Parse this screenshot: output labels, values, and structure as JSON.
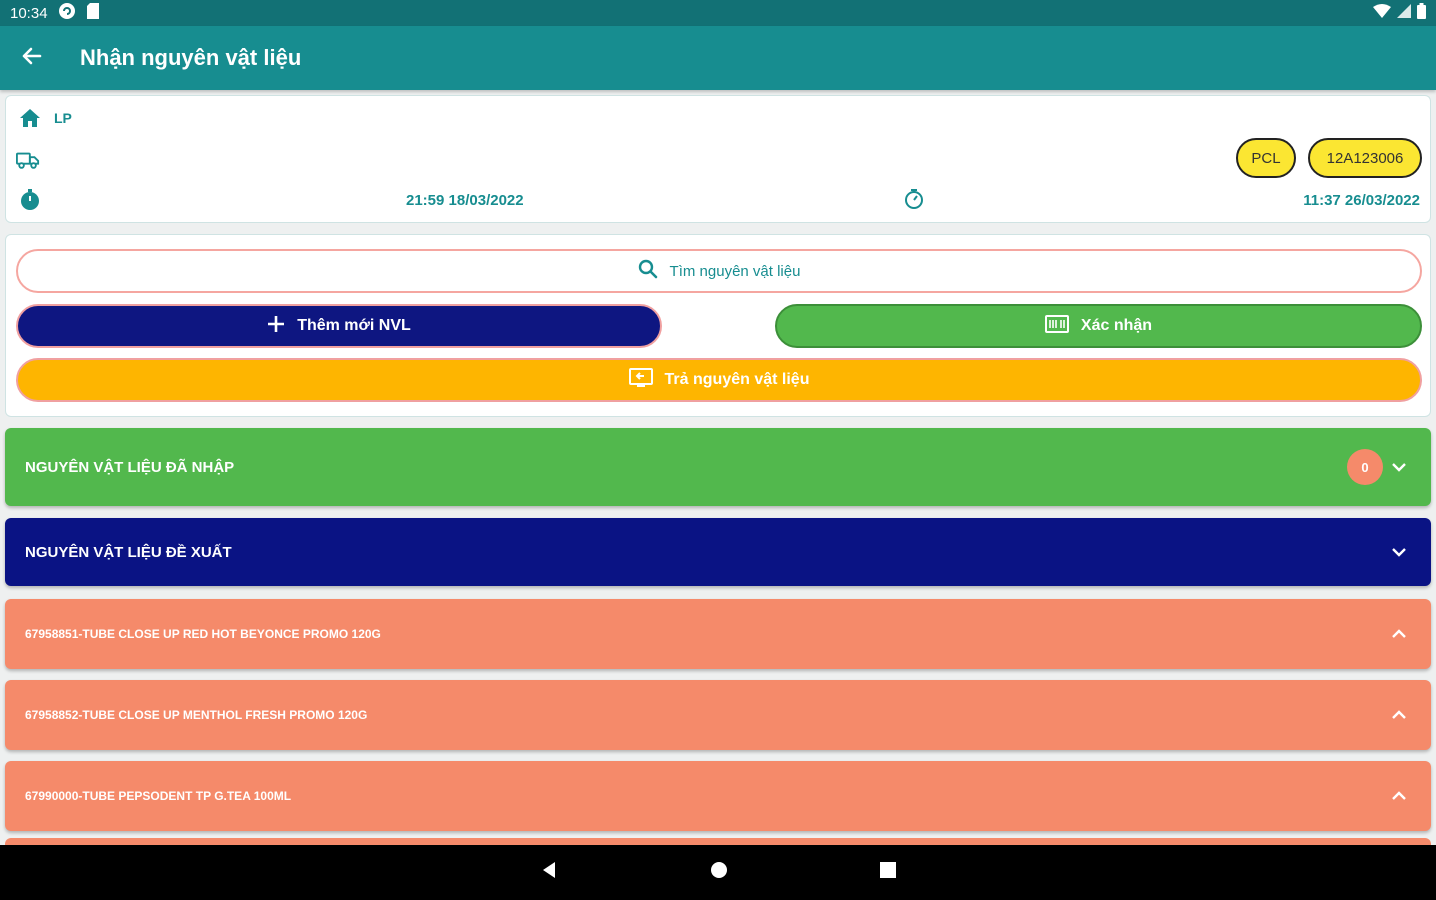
{
  "status_bar": {
    "time": "10:34",
    "left_icons": [
      "sync-icon",
      "sd-card-icon"
    ],
    "right_icons": [
      "wifi-icon",
      "signal-icon",
      "battery-icon"
    ]
  },
  "app_bar": {
    "title": "Nhận nguyên vật liệu",
    "back_icon": "arrow-left-icon"
  },
  "info": {
    "location": "LP",
    "chips": [
      "PCL",
      "12A123006"
    ],
    "start_time": "21:59 18/03/2022",
    "end_time": "11:37 26/03/2022"
  },
  "actions": {
    "search_placeholder": "Tìm nguyên vật liệu",
    "add_label": "Thêm mới NVL",
    "confirm_label": "Xác nhận",
    "return_label": "Trả nguyên vật liệu"
  },
  "sections": {
    "received": {
      "title": "NGUYÊN VẬT LIỆU ĐÃ NHẬP",
      "count": "0"
    },
    "proposed": {
      "title": "NGUYÊN VẬT LIỆU ĐỀ XUẤT"
    }
  },
  "items": [
    {
      "label": "67958851-TUBE CLOSE UP RED HOT BEYONCE PROMO 120G"
    },
    {
      "label": "67958852-TUBE CLOSE UP MENTHOL FRESH PROMO 120G"
    },
    {
      "label": "67990000-TUBE PEPSODENT TP G.TEA 100ML"
    }
  ],
  "colors": {
    "app_bar": "#178d90",
    "status_bar": "#127175",
    "green": "#52b84d",
    "navy": "#0e1681",
    "amber": "#feb500",
    "salmon": "#f58a6a",
    "chip_yellow": "#fbe632"
  }
}
